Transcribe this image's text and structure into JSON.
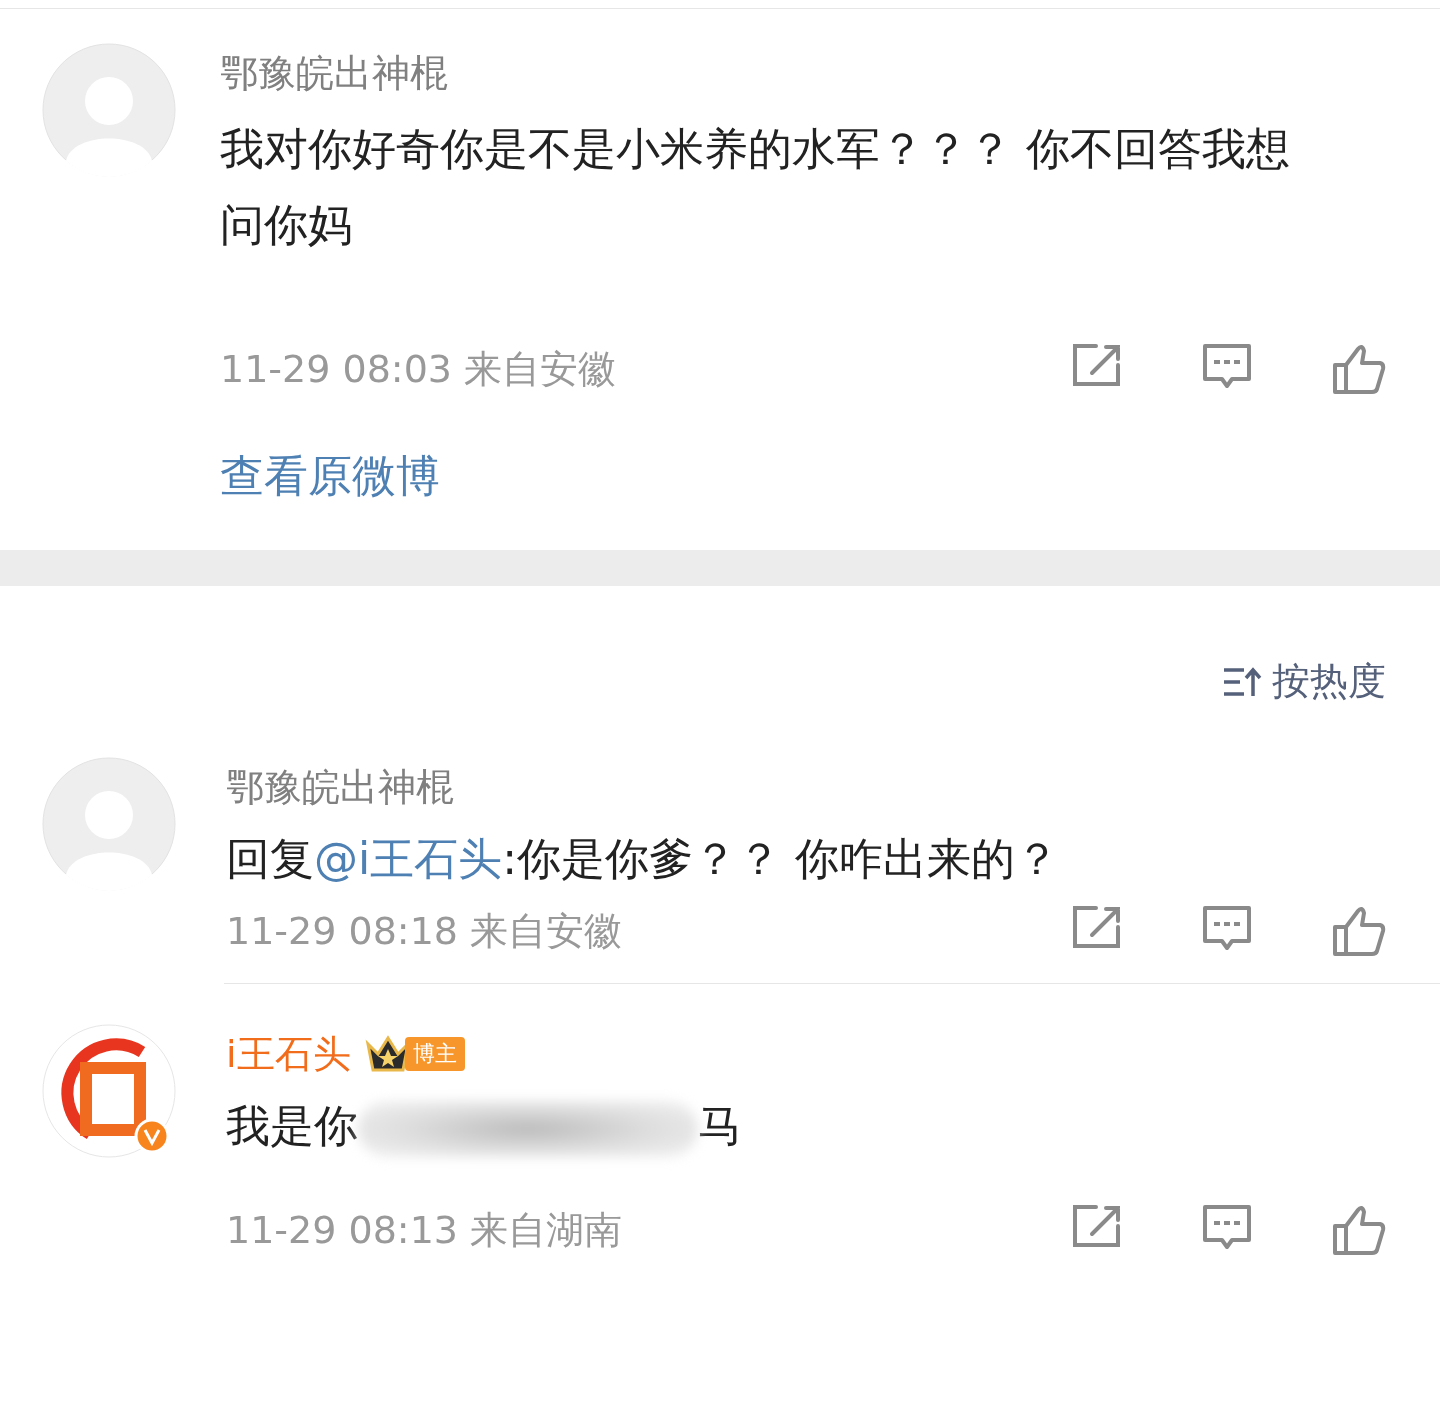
{
  "post_comment": {
    "author": "鄂豫皖出神棍",
    "avatar": {
      "kind": "default"
    },
    "text": "我对你好奇你是不是小米养的水军？？？ 你不回答我想问你妈",
    "time": "11-29 08:03",
    "location": "来自安徽",
    "link": "查看原微博"
  },
  "sort": {
    "label": "按热度"
  },
  "replies": [
    {
      "author": "鄂豫皖出神棍",
      "avatar": {
        "kind": "default"
      },
      "is_blogger": false,
      "reply_prefix": "回复",
      "mention": "@i王石头",
      "text": ":你是你爹？？ 你咋出来的？",
      "time": "11-29 08:18",
      "location": "来自安徽"
    },
    {
      "author": "i王石头",
      "avatar": {
        "kind": "logo"
      },
      "is_blogger": true,
      "badge": "博主",
      "text": "我是你",
      "obscured": true,
      "text_after": "马",
      "time": "11-29 08:13",
      "location": "来自湖南"
    }
  ]
}
